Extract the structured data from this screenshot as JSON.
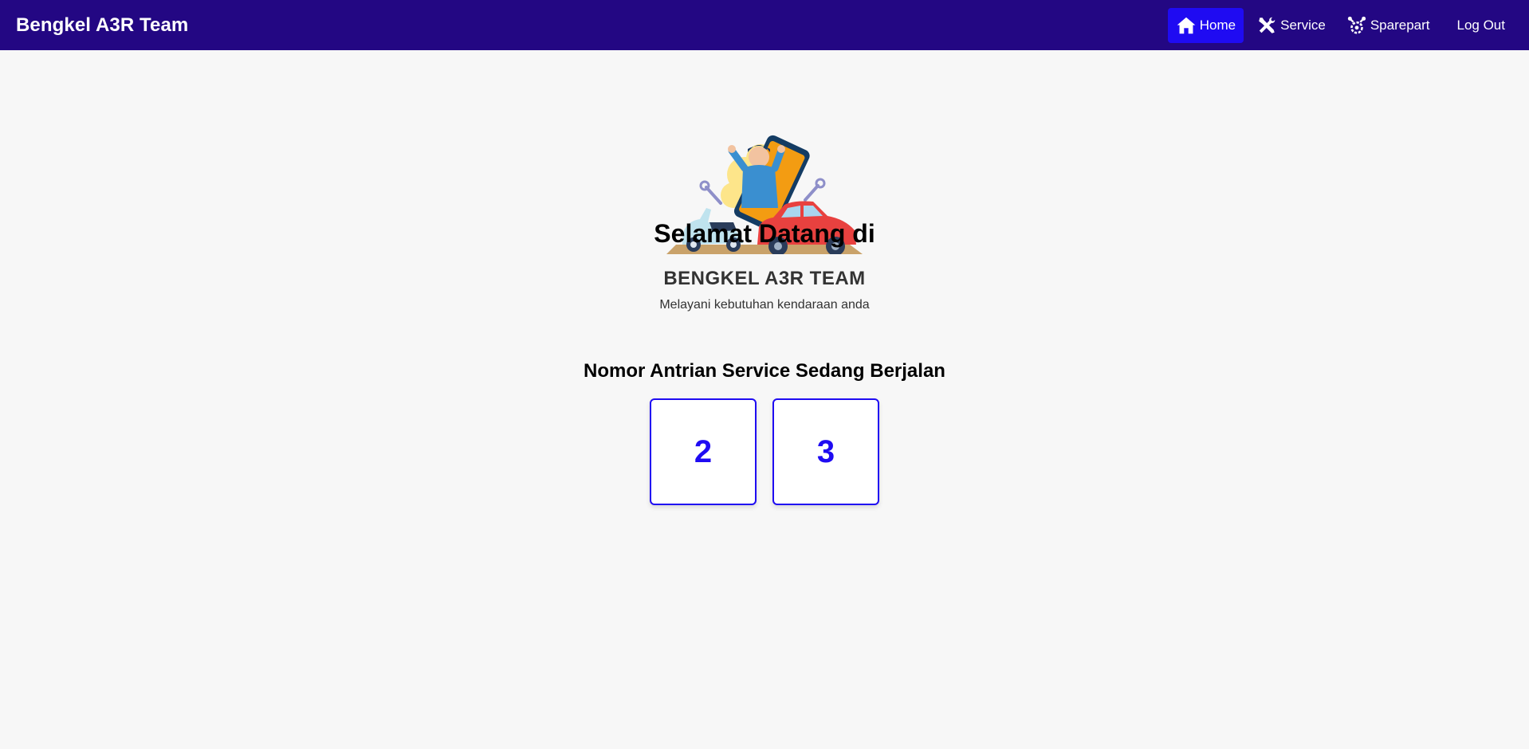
{
  "header": {
    "brand": "Bengkel A3R Team"
  },
  "nav": {
    "items": [
      {
        "label": "Home",
        "icon": "home-icon",
        "active": true
      },
      {
        "label": "Service",
        "icon": "tools-icon",
        "active": false
      },
      {
        "label": "Sparepart",
        "icon": "engine-icon",
        "active": false
      },
      {
        "label": "Log Out",
        "icon": "",
        "active": false
      }
    ]
  },
  "hero": {
    "illustration": "mechanic-with-scooter-and-car-illustration",
    "welcome": "Selamat Datang di",
    "shop_name": "BENGKEL A3R TEAM",
    "tagline": "Melayani kebutuhan kendaraan anda"
  },
  "queue": {
    "title": "Nomor Antrian Service Sedang Berjalan",
    "numbers": [
      "2",
      "3"
    ]
  },
  "colors": {
    "navbar": "#230783",
    "accent": "#1f0bf2",
    "background": "#f7f7f7"
  }
}
